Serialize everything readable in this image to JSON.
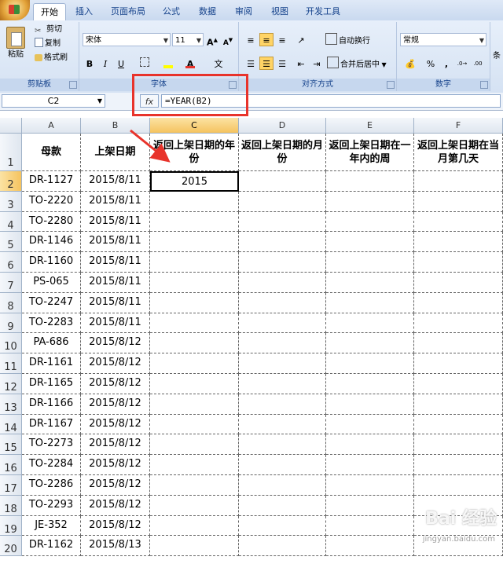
{
  "ribbon": {
    "tabs": [
      "开始",
      "插入",
      "页面布局",
      "公式",
      "数据",
      "审阅",
      "视图",
      "开发工具"
    ],
    "clipboard": {
      "paste": "粘贴",
      "cut": "剪切",
      "copy": "复制",
      "format_painter": "格式刷",
      "label": "剪贴板"
    },
    "font": {
      "name": "宋体",
      "size": "11",
      "label": "字体",
      "bold": "B",
      "italic": "I",
      "underline": "U"
    },
    "alignment": {
      "wrap": "自动换行",
      "merge": "合并后居中",
      "label": "对齐方式"
    },
    "number": {
      "format": "常规",
      "label": "数字",
      "percent": "%",
      "comma": ","
    },
    "styles": {
      "cond": "条"
    }
  },
  "formula_bar": {
    "name_box": "C2",
    "fx": "fx",
    "formula": "=YEAR(B2)"
  },
  "sheet": {
    "columns": [
      "A",
      "B",
      "C",
      "D",
      "E",
      "F"
    ],
    "header_row": [
      "母款",
      "上架日期",
      "返回上架日期的年份",
      "返回上架日期的月份",
      "返回上架日期在一年内的周",
      "返回上架日期在当月第几天"
    ],
    "rows": [
      {
        "num": "2",
        "a": "DR-1127",
        "b": "2015/8/11",
        "c": "2015"
      },
      {
        "num": "3",
        "a": "TO-2220",
        "b": "2015/8/11",
        "c": ""
      },
      {
        "num": "4",
        "a": "TO-2280",
        "b": "2015/8/11",
        "c": ""
      },
      {
        "num": "5",
        "a": "DR-1146",
        "b": "2015/8/11",
        "c": ""
      },
      {
        "num": "6",
        "a": "DR-1160",
        "b": "2015/8/11",
        "c": ""
      },
      {
        "num": "7",
        "a": "PS-065",
        "b": "2015/8/11",
        "c": ""
      },
      {
        "num": "8",
        "a": "TO-2247",
        "b": "2015/8/11",
        "c": ""
      },
      {
        "num": "9",
        "a": "TO-2283",
        "b": "2015/8/11",
        "c": ""
      },
      {
        "num": "10",
        "a": "PA-686",
        "b": "2015/8/12",
        "c": ""
      },
      {
        "num": "11",
        "a": "DR-1161",
        "b": "2015/8/12",
        "c": ""
      },
      {
        "num": "12",
        "a": "DR-1165",
        "b": "2015/8/12",
        "c": ""
      },
      {
        "num": "13",
        "a": "DR-1166",
        "b": "2015/8/12",
        "c": ""
      },
      {
        "num": "14",
        "a": "DR-1167",
        "b": "2015/8/12",
        "c": ""
      },
      {
        "num": "15",
        "a": "TO-2273",
        "b": "2015/8/12",
        "c": ""
      },
      {
        "num": "16",
        "a": "TO-2284",
        "b": "2015/8/12",
        "c": ""
      },
      {
        "num": "17",
        "a": "TO-2286",
        "b": "2015/8/12",
        "c": ""
      },
      {
        "num": "18",
        "a": "TO-2293",
        "b": "2015/8/12",
        "c": ""
      },
      {
        "num": "19",
        "a": "JE-352",
        "b": "2015/8/12",
        "c": ""
      },
      {
        "num": "20",
        "a": "DR-1162",
        "b": "2015/8/13",
        "c": ""
      }
    ],
    "header_row_num": "1"
  },
  "watermark": {
    "text": "Bai 经验",
    "sub": "jingyan.baidu.com"
  },
  "colors": {
    "annotation": "#e8332b",
    "selection": "#f5c35f"
  }
}
